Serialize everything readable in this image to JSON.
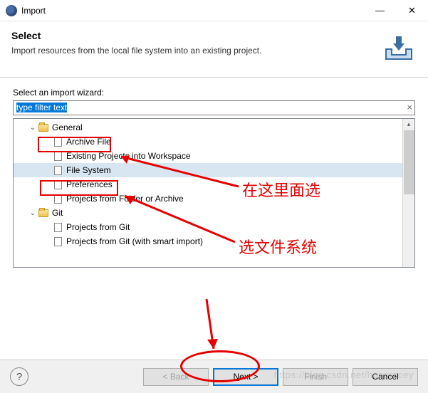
{
  "window": {
    "title": "Import"
  },
  "header": {
    "heading": "Select",
    "description": "Import resources from the local file system into an existing project."
  },
  "content": {
    "wizardLabel": "Select an import wizard:",
    "filterText": "type filter text",
    "tree": {
      "items": [
        {
          "label": "General",
          "type": "folder",
          "level": 1,
          "expanded": true
        },
        {
          "label": "Archive File",
          "type": "leaf",
          "level": 2
        },
        {
          "label": "Existing Projects into Workspace",
          "type": "leaf",
          "level": 2
        },
        {
          "label": "File System",
          "type": "leaf",
          "level": 2,
          "selected": true
        },
        {
          "label": "Preferences",
          "type": "leaf",
          "level": 2
        },
        {
          "label": "Projects from Folder or Archive",
          "type": "leaf",
          "level": 2
        },
        {
          "label": "Git",
          "type": "folder",
          "level": 1,
          "expanded": true
        },
        {
          "label": "Projects from Git",
          "type": "leaf",
          "level": 2
        },
        {
          "label": "Projects from Git (with smart import)",
          "type": "leaf",
          "level": 2
        }
      ]
    }
  },
  "buttons": {
    "back": "< Back",
    "next": "Next >",
    "finish": "Finish",
    "cancel": "Cancel"
  },
  "annotations": {
    "text1": "在这里面选",
    "text2": "选文件系统"
  },
  "watermark": "https://blog.csdn.net/honorzoey"
}
